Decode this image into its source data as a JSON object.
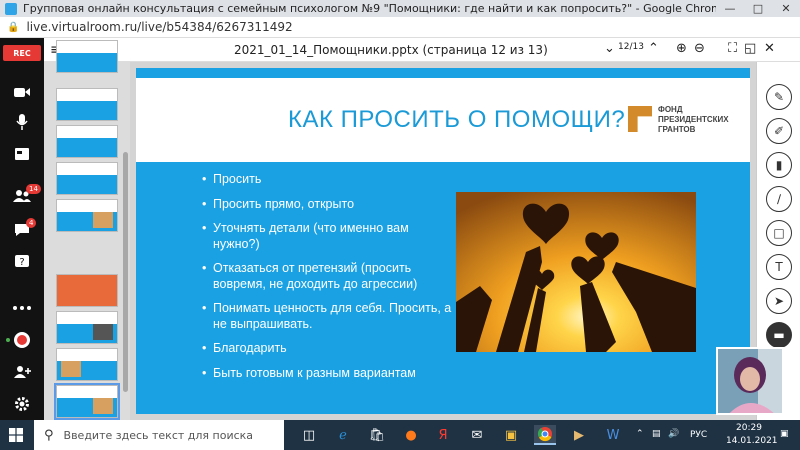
{
  "window": {
    "title": "Групповая онлайн консультация с семейным психологом №9 \"Помощники: где найти и как попросить?\" - Google Chrome",
    "url": "live.virtualroom.ru/live/b54384/6267311492"
  },
  "rail": {
    "rec_label": "REC",
    "participants_badge": "14",
    "chat_badge": "4"
  },
  "pdf_toolbar": {
    "sidebar_page": "1",
    "filename": "2021_01_14_Помощники.pptx (страница 12 из 13)",
    "page_indicator": "12/13"
  },
  "slide": {
    "heading": "КАК ПРОСИТЬ О ПОМОЩИ?",
    "logo_lines": [
      "ФОНД",
      "ПРЕЗИДЕНТСКИХ",
      "ГРАНТОВ"
    ],
    "bullets": [
      "Просить",
      "Просить прямо, открыто",
      "Уточнять детали (что именно вам нужно?)",
      "Отказаться от претензий (просить вовремя, не доходить до агрессии)",
      "Понимать ценность для себя. Просить, а не выпрашивать.",
      "Благодарить",
      "Быть готовым к разным вариантам"
    ]
  },
  "taskbar": {
    "search_placeholder": "Введите здесь текст для поиска",
    "language": "РУС",
    "time": "20:29",
    "date": "14.01.2021"
  }
}
